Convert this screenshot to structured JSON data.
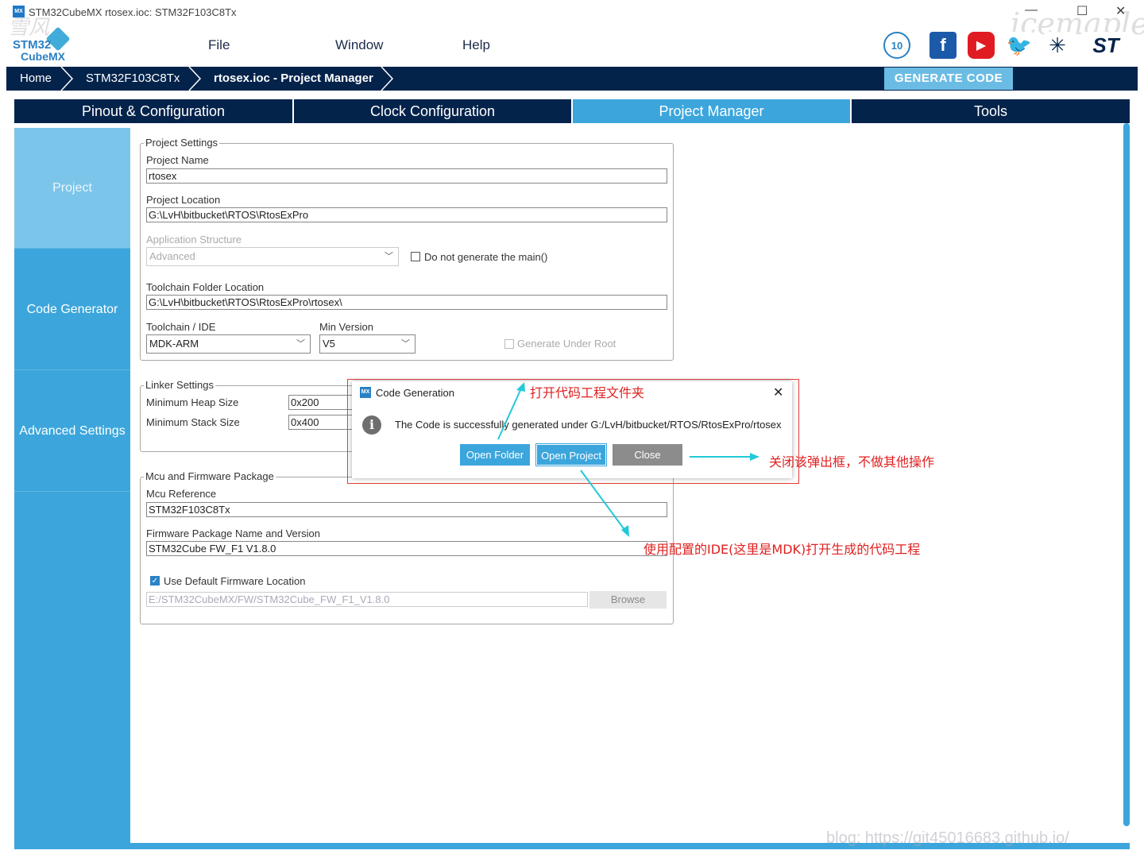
{
  "window": {
    "title": "STM32CubeMX rtosex.ioc: STM32F103C8Tx",
    "icon_text": "MX",
    "minimize": "—",
    "maximize": "☐",
    "close": "✕"
  },
  "logo": {
    "line1": "STM32",
    "line2": "CubeMX"
  },
  "watermarks": {
    "top": "icemaple",
    "left": "雪风",
    "bottom": "blog: https://git45016683.github.io/"
  },
  "menu": [
    "File",
    "Window",
    "Help"
  ],
  "social": [
    "10",
    "f",
    "▶",
    "🐦",
    "✳",
    "ST"
  ],
  "breadcrumb": [
    "Home",
    "STM32F103C8Tx",
    "rtosex.ioc - Project Manager"
  ],
  "generate_button": "GENERATE CODE",
  "tabs": [
    "Pinout & Configuration",
    "Clock Configuration",
    "Project Manager",
    "Tools"
  ],
  "sidebar": [
    "Project",
    "Code Generator",
    "Advanced Settings"
  ],
  "project_settings": {
    "legend": "Project Settings",
    "name_label": "Project Name",
    "name_value": "rtosex",
    "location_label": "Project Location",
    "location_value": "G:\\LvH\\bitbucket\\RTOS\\RtosExPro",
    "app_structure_label": "Application Structure",
    "app_structure_value": "Advanced",
    "no_main_label": "Do not generate the main()",
    "toolchain_folder_label": "Toolchain Folder Location",
    "toolchain_folder_value": "G:\\LvH\\bitbucket\\RTOS\\RtosExPro\\rtosex\\",
    "toolchain_label": "Toolchain / IDE",
    "toolchain_value": "MDK-ARM",
    "min_version_label": "Min Version",
    "min_version_value": "V5",
    "gen_under_root_label": "Generate Under Root"
  },
  "linker_settings": {
    "legend": "Linker Settings",
    "heap_label": "Minimum Heap Size",
    "heap_value": "0x200",
    "stack_label": "Minimum Stack Size",
    "stack_value": "0x400"
  },
  "mcu_package": {
    "legend": "Mcu and Firmware Package",
    "mcu_ref_label": "Mcu Reference",
    "mcu_ref_value": "STM32F103C8Tx",
    "fw_label": "Firmware Package Name and Version",
    "fw_value": "STM32Cube FW_F1 V1.8.0",
    "use_default_label": "Use Default Firmware Location",
    "fw_location_value": "E:/STM32CubeMX/FW/STM32Cube_FW_F1_V1.8.0",
    "browse_label": "Browse"
  },
  "dialog": {
    "title": "Code Generation",
    "icon_text": "MX",
    "close": "✕",
    "info_icon": "i",
    "message": "The Code is successfully generated under G:/LvH/bitbucket/RTOS/RtosExPro/rtosex",
    "open_folder": "Open Folder",
    "open_project": "Open Project",
    "close_button": "Close"
  },
  "annotations": {
    "open_folder_note": "打开代码工程文件夹",
    "close_note": "关闭该弹出框，不做其他操作",
    "open_project_note": "使用配置的IDE(这里是MDK)打开生成的代码工程"
  },
  "colors": {
    "navy": "#03234b",
    "accent": "#3ca6dc",
    "accent_light": "#7cc5ea",
    "annotation": "#e02020",
    "arrow": "#22c9d8"
  }
}
